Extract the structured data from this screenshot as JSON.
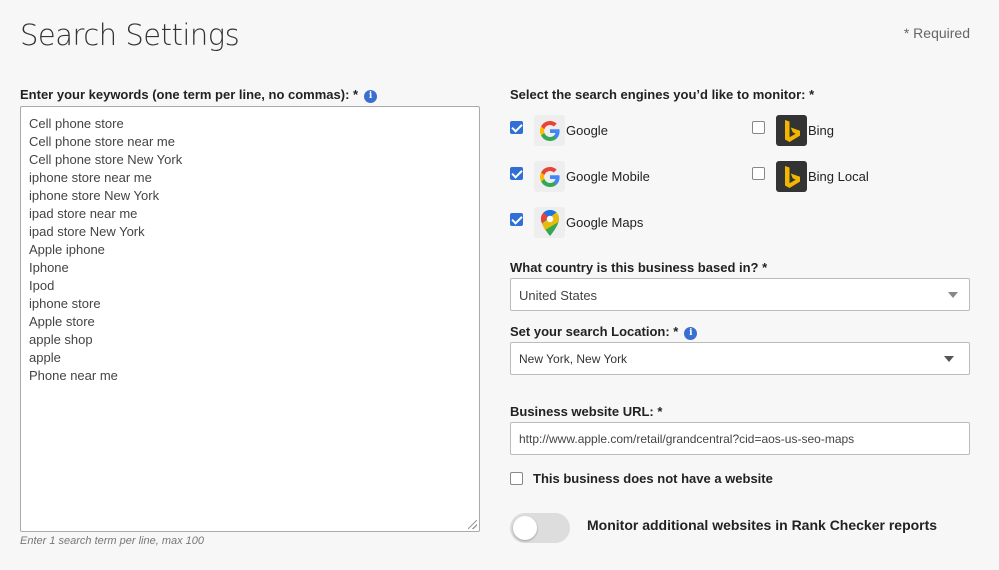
{
  "header": {
    "title": "Search Settings",
    "required_note": "* Required"
  },
  "keywords": {
    "label": "Enter your keywords (one term per line, no commas): *",
    "info_icon": "info-icon",
    "lines": [
      "Cell phone store",
      "Cell phone store near me",
      "Cell phone store New York",
      "iphone store near me",
      "iphone store New York",
      "ipad store near me",
      "ipad store New York",
      "Apple iphone",
      "Iphone",
      "Ipod",
      "iphone store",
      "Apple store",
      "apple shop",
      "apple",
      "Phone near me"
    ],
    "hint": "Enter 1 search term per line, max 100"
  },
  "engines": {
    "label": "Select the search engines you’d like to monitor: *",
    "items": [
      {
        "name": "Google",
        "checked": true,
        "icon": "google-icon"
      },
      {
        "name": "Google Mobile",
        "checked": true,
        "icon": "google-icon"
      },
      {
        "name": "Google Maps",
        "checked": true,
        "icon": "google-maps-icon"
      },
      {
        "name": "Bing",
        "checked": false,
        "icon": "bing-icon"
      },
      {
        "name": "Bing Local",
        "checked": false,
        "icon": "bing-icon"
      }
    ]
  },
  "country": {
    "label": "What country is this business based in? *",
    "value": "United States"
  },
  "location": {
    "label": "Set your search Location: *",
    "value": "New York, New York"
  },
  "website": {
    "label": "Business website URL: *",
    "value": "http://www.apple.com/retail/grandcentral?cid=aos-us-seo-maps"
  },
  "no_website": {
    "label": "This business does not have a website",
    "checked": false
  },
  "monitor": {
    "label": "Monitor additional websites in Rank Checker reports",
    "enabled": false
  },
  "colors": {
    "accent": "#2f6fd6",
    "bing": "#f2b500",
    "background": "#f7f7f7"
  }
}
